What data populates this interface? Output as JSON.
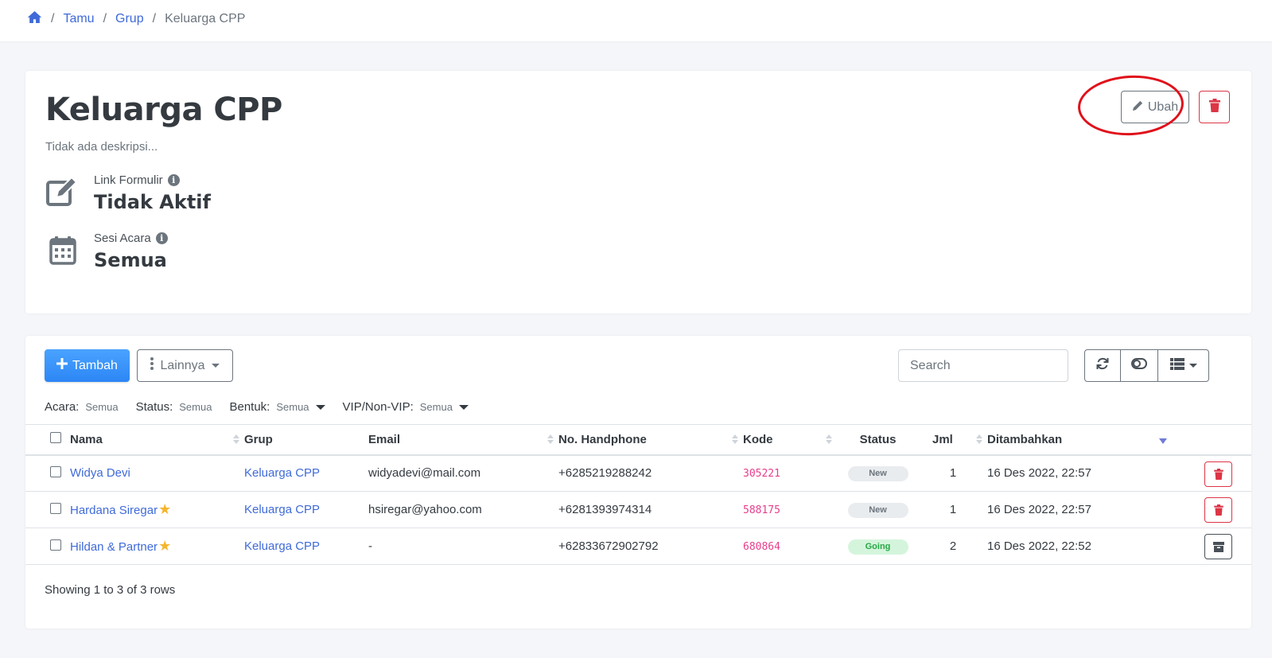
{
  "breadcrumb": {
    "home_icon": "home-icon",
    "items": [
      "Tamu",
      "Grup"
    ],
    "current": "Keluarga CPP",
    "separator": "/"
  },
  "group": {
    "title": "Keluarga CPP",
    "description": "Tidak ada deskripsi...",
    "edit_label": "Ubah",
    "link_formulir_label": "Link Formulir",
    "link_formulir_value": "Tidak Aktif",
    "sesi_acara_label": "Sesi Acara",
    "sesi_acara_value": "Semua",
    "info_glyph": "i"
  },
  "toolbar": {
    "add_label": "Tambah",
    "more_label": "Lainnya",
    "search_placeholder": "Search"
  },
  "filters": [
    {
      "label": "Acara:",
      "value": "Semua",
      "dropdown": false
    },
    {
      "label": "Status:",
      "value": "Semua",
      "dropdown": false
    },
    {
      "label": "Bentuk:",
      "value": "Semua",
      "dropdown": true
    },
    {
      "label": "VIP/Non-VIP:",
      "value": "Semua",
      "dropdown": true
    }
  ],
  "table": {
    "columns": [
      "Nama",
      "Grup",
      "Email",
      "No. Handphone",
      "Kode",
      "Status",
      "Jml",
      "Ditambahkan"
    ],
    "rows": [
      {
        "nama": "Widya Devi",
        "vip": false,
        "grup": "Keluarga CPP",
        "email": "widyadevi@mail.com",
        "phone": "+6285219288242",
        "kode": "305221",
        "status": "New",
        "jml": "1",
        "ditambahkan": "16 Des 2022, 22:57",
        "action": "delete"
      },
      {
        "nama": "Hardana Siregar",
        "vip": true,
        "grup": "Keluarga CPP",
        "email": "hsiregar@yahoo.com",
        "phone": "+6281393974314",
        "kode": "588175",
        "status": "New",
        "jml": "1",
        "ditambahkan": "16 Des 2022, 22:57",
        "action": "delete"
      },
      {
        "nama": "Hildan & Partner",
        "vip": true,
        "grup": "Keluarga CPP",
        "email": "-",
        "phone": "+62833672902792",
        "kode": "680864",
        "status": "Going",
        "jml": "2",
        "ditambahkan": "16 Des 2022, 22:52",
        "action": "archive"
      }
    ],
    "footer": "Showing 1 to 3 of 3 rows"
  },
  "colors": {
    "link": "#3f6ad8",
    "primary": "#2c86f5",
    "danger": "#dc3545",
    "code": "#e83e8c",
    "annotation": "#e0101a"
  }
}
